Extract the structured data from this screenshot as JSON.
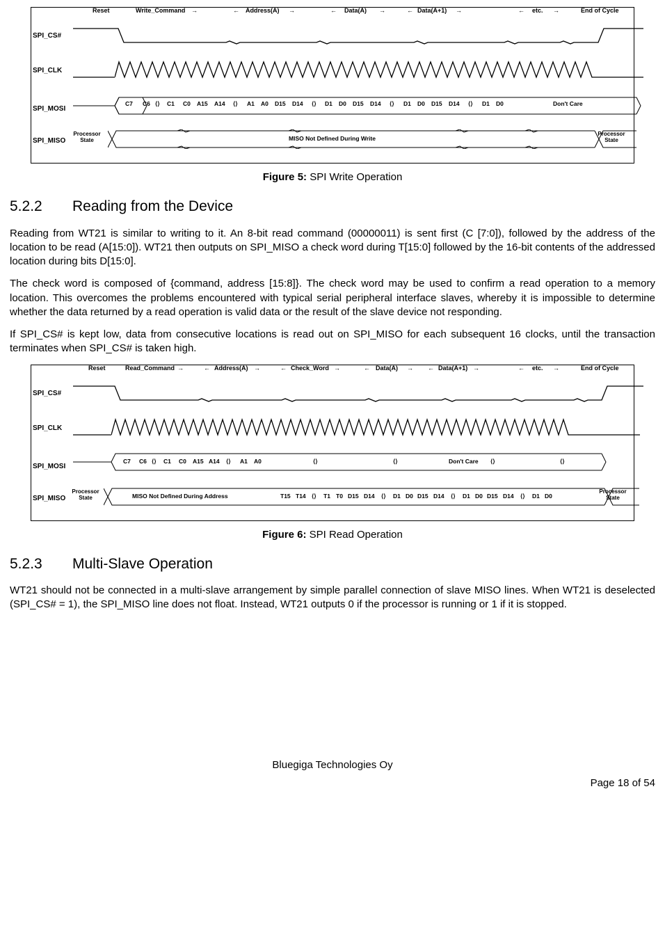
{
  "figure5": {
    "caption_bold": "Figure 5:",
    "caption_rest": " SPI Write Operation",
    "signals": [
      "SPI_CS#",
      "SPI_CLK",
      "SPI_MOSI",
      "SPI_MISO"
    ],
    "top_labels": [
      "Reset",
      "Write_Command",
      "Address(A)",
      "Data(A)",
      "Data(A+1)",
      "etc.",
      "End of Cycle"
    ],
    "mosi_bits": [
      "C7",
      "C6",
      "C1",
      "C0",
      "A15",
      "A14",
      "A1",
      "A0",
      "D15",
      "D14",
      "D1",
      "D0",
      "D15",
      "D14",
      "D1",
      "D0",
      "D15",
      "D14",
      "D1",
      "D0",
      "Don't Care"
    ],
    "miso_left": "Processor State",
    "miso_mid": "MISO Not Defined During Write",
    "miso_right": "Processor State"
  },
  "section_5_2_2": {
    "number": "5.2.2",
    "title": "Reading from the Device",
    "p1": "Reading from WT21 is similar to writing to it. An 8-bit read command (00000011) is sent first (C [7:0]), followed by the address of the location to be read (A[15:0]). WT21 then outputs on SPI_MISO a check word during T[15:0] followed by the 16-bit contents of the addressed location during bits D[15:0].",
    "p2": "The check word is composed of {command, address [15:8]}. The check word may be used to confirm a read operation to a memory location. This overcomes the problems encountered with typical serial peripheral interface slaves, whereby it is impossible to determine whether the data returned by a read operation is valid data or the result of the slave device not responding.",
    "p3": "If SPI_CS# is kept low, data from consecutive locations is read out on SPI_MISO for each subsequent 16 clocks, until the transaction terminates when SPI_CS# is taken high."
  },
  "figure6": {
    "caption_bold": "Figure 6:",
    "caption_rest": " SPI Read Operation",
    "signals": [
      "SPI_CS#",
      "SPI_CLK",
      "SPI_MOSI",
      "SPI_MISO"
    ],
    "top_labels": [
      "Reset",
      "Read_Command",
      "Address(A)",
      "Check_Word",
      "Data(A)",
      "Data(A+1)",
      "etc.",
      "End of Cycle"
    ],
    "mosi_bits": [
      "C7",
      "C6",
      "C1",
      "C0",
      "A15",
      "A14",
      "A1",
      "A0",
      "Don't Care"
    ],
    "miso_left": "Processor State",
    "miso_addr": "MISO Not Defined During Address",
    "miso_bits": [
      "T15",
      "T14",
      "T1",
      "T0",
      "D15",
      "D14",
      "D1",
      "D0",
      "D15",
      "D14",
      "D1",
      "D0",
      "D15",
      "D14",
      "D1",
      "D0"
    ],
    "miso_right": "Processor State"
  },
  "section_5_2_3": {
    "number": "5.2.3",
    "title": "Multi-Slave Operation",
    "p1": "WT21 should not be connected in a multi-slave arrangement by simple parallel connection of slave MISO lines. When WT21 is deselected (SPI_CS# = 1), the SPI_MISO line does not float. Instead, WT21 outputs 0 if the processor is running or 1 if it is stopped."
  },
  "footer": {
    "company": "Bluegiga Technologies Oy",
    "page": "Page 18 of 54"
  }
}
